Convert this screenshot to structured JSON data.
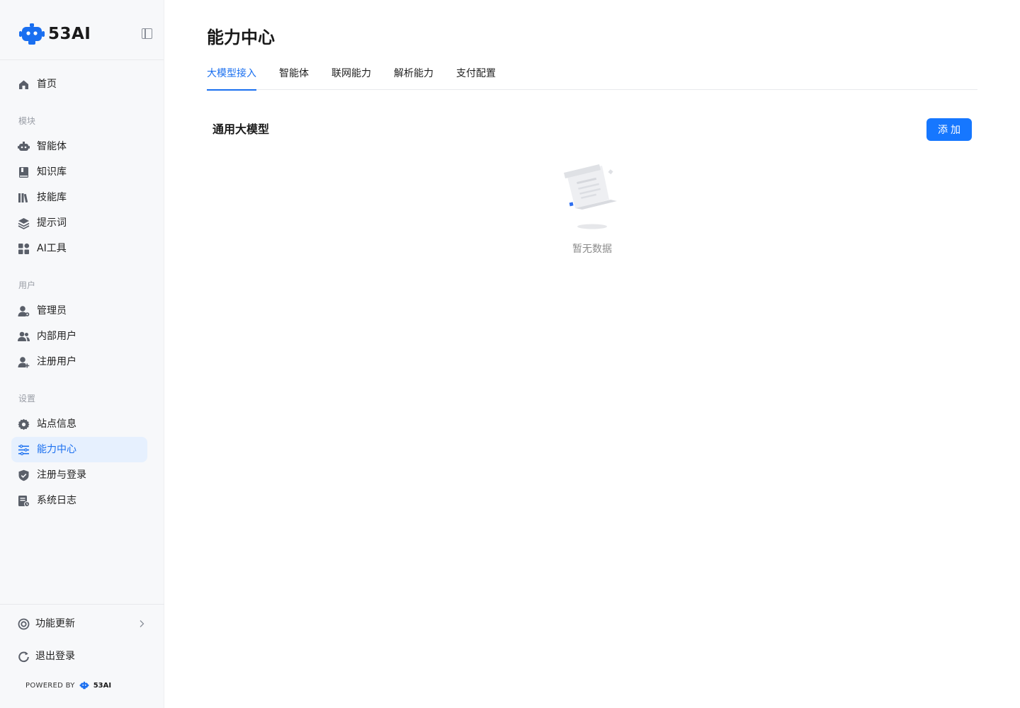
{
  "brand": {
    "name": "53AI"
  },
  "sidebar": {
    "home": {
      "label": "首页",
      "icon": "home-icon"
    },
    "sections": [
      {
        "label": "模块"
      },
      {
        "label": "用户"
      },
      {
        "label": "设置"
      }
    ],
    "items": [
      {
        "label": "智能体",
        "icon": "robot-icon"
      },
      {
        "label": "知识库",
        "icon": "book-icon"
      },
      {
        "label": "技能库",
        "icon": "library-icon"
      },
      {
        "label": "提示词",
        "icon": "layers-icon"
      },
      {
        "label": "AI工具",
        "icon": "apps-icon"
      },
      {
        "label": "管理员",
        "icon": "admin-user-icon"
      },
      {
        "label": "内部用户",
        "icon": "users-icon"
      },
      {
        "label": "注册用户",
        "icon": "user-add-icon"
      },
      {
        "label": "站点信息",
        "icon": "gear-icon"
      },
      {
        "label": "能力中心",
        "icon": "sliders-icon",
        "active": true
      },
      {
        "label": "注册与登录",
        "icon": "shield-icon"
      },
      {
        "label": "系统日志",
        "icon": "log-icon"
      }
    ],
    "bottom": {
      "updates": {
        "label": "功能更新",
        "icon": "update-icon"
      },
      "logout": {
        "label": "退出登录",
        "icon": "logout-icon"
      }
    },
    "powered_by": "POWERED BY",
    "powered_name": "53AI"
  },
  "main": {
    "title": "能力中心",
    "tabs": [
      {
        "label": "大模型接入",
        "active": true
      },
      {
        "label": "智能体"
      },
      {
        "label": "联网能力"
      },
      {
        "label": "解析能力"
      },
      {
        "label": "支付配置"
      }
    ],
    "section_title": "通用大模型",
    "add_button": "添加",
    "empty_text": "暂无数据"
  },
  "colors": {
    "accent": "#1677ff",
    "active_bg": "#e6f0fe",
    "sidebar_bg": "#f7f8fa"
  }
}
